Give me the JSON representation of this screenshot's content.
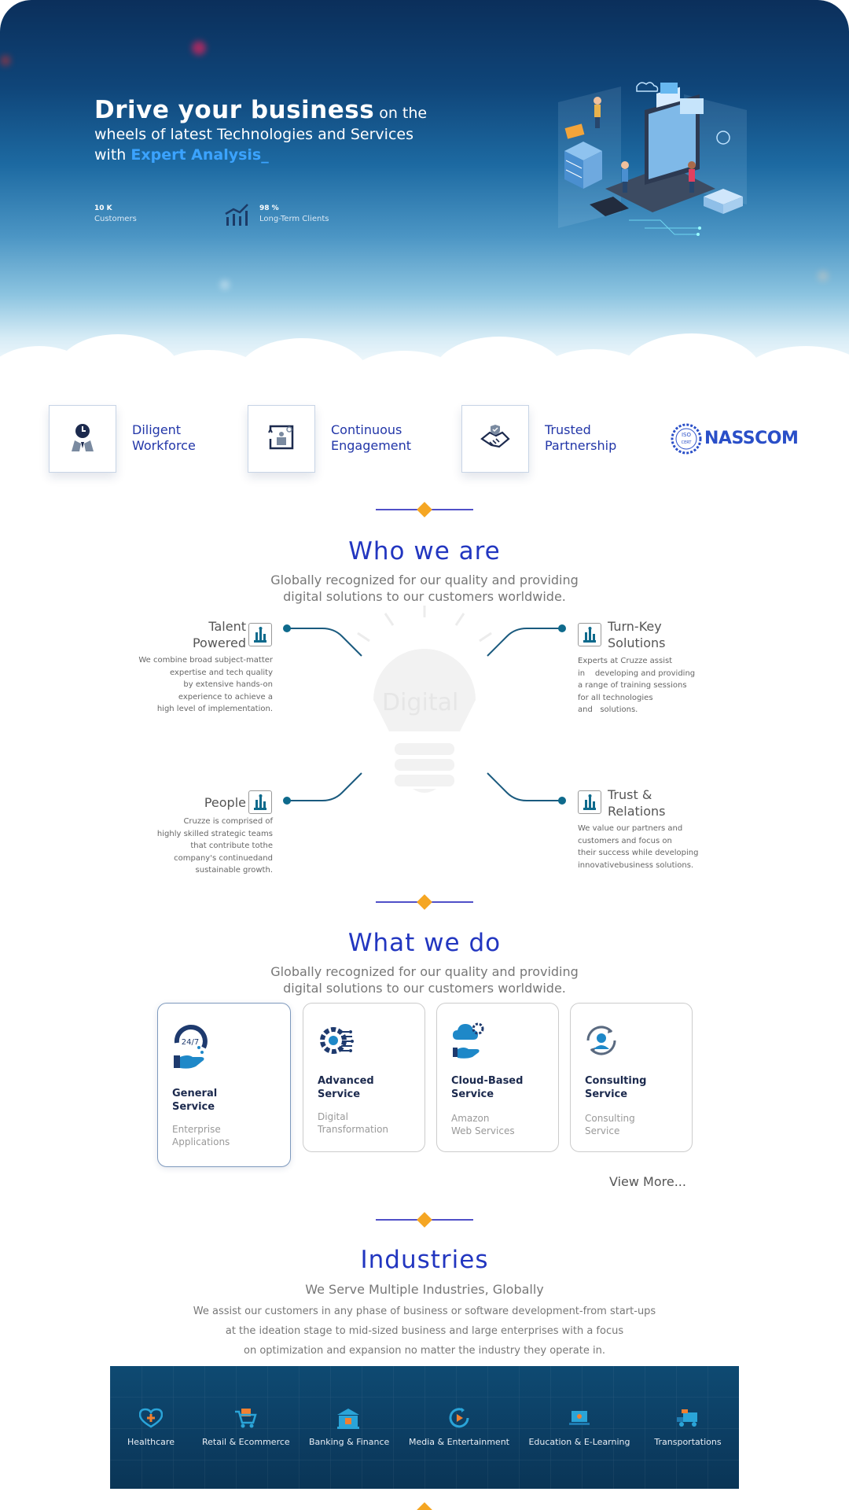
{
  "hero": {
    "headline_big": "Drive your business",
    "headline_small": " on the",
    "line2": "wheels of latest Technologies and Services",
    "line3_prefix": "with ",
    "line3_accent": "Expert Analysis_",
    "stats": [
      {
        "value": "10 K",
        "label": "Customers"
      },
      {
        "value": "98 %",
        "label": "Long-Term Clients"
      }
    ]
  },
  "features": [
    {
      "line1": "Diligent",
      "line2": "Workforce",
      "icon": "workforce-icon"
    },
    {
      "line1": "Continuous",
      "line2": "Engagement",
      "icon": "engagement-icon"
    },
    {
      "line1": "Trusted",
      "line2": "Partnership",
      "icon": "handshake-icon"
    }
  ],
  "nasscom": {
    "label": "NASSCOM",
    "badge": "ISO CERTIFIED"
  },
  "who": {
    "title": "Who we are",
    "sub1": "Globally recognized for our quality and providing",
    "sub2": "digital solutions to our customers worldwide.",
    "bulb_text": "Digital",
    "items": [
      {
        "title1": "Talent",
        "title2": "Powered",
        "desc": [
          "We combine broad subject-matter",
          "expertise and tech quality",
          "by extensive hands-on",
          "experience to achieve a",
          "high level of implementation."
        ]
      },
      {
        "title1": "Turn-Key",
        "title2": "Solutions",
        "desc": [
          "Experts at Cruzze assist",
          "in    developing and providing",
          "a range of training sessions",
          "for all technologies",
          "and   solutions."
        ]
      },
      {
        "title1": "People",
        "title2": "",
        "desc": [
          "Cruzze is comprised of",
          "highly skilled strategic teams",
          "that contribute tothe",
          "company's continuedand",
          "sustainable growth."
        ]
      },
      {
        "title1": "Trust &",
        "title2": "Relations",
        "desc": [
          "We value our partners and",
          "customers and focus on",
          "their success while developing",
          "innovativebusiness solutions."
        ]
      }
    ]
  },
  "what": {
    "title": "What we do",
    "sub1": "Globally recognized for our quality and providing",
    "sub2": "digital solutions to our customers worldwide.",
    "cards": [
      {
        "t1": "General",
        "t2": "Service",
        "s1": "Enterprise",
        "s2": "Applications",
        "icon": "24-7-support-icon"
      },
      {
        "t1": "Advanced",
        "t2": "Service",
        "s1": "Digital",
        "s2": "Transformation",
        "icon": "gear-circuit-icon"
      },
      {
        "t1": "Cloud-Based",
        "t2": "Service",
        "s1": "Amazon",
        "s2": "Web Services",
        "icon": "cloud-hand-icon"
      },
      {
        "t1": "Consulting",
        "t2": "Service",
        "s1": "Consulting",
        "s2": "Service",
        "icon": "consultant-icon"
      }
    ],
    "view_more": "View More..."
  },
  "industries": {
    "title": "Industries",
    "sub": "We Serve Multiple Industries, Globally",
    "desc": [
      "We assist our customers in any phase of business or software development-from start-ups",
      "at the ideation stage to mid-sized business and large enterprises with a focus",
      "on optimization and expansion no matter the industry they operate in."
    ],
    "items": [
      {
        "label": "Healthcare",
        "icon": "heart-plus-icon"
      },
      {
        "label": "Retail & Ecommerce",
        "icon": "shopping-cart-icon"
      },
      {
        "label": "Banking & Finance",
        "icon": "bank-icon"
      },
      {
        "label": "Media & Entertainment",
        "icon": "media-play-icon"
      },
      {
        "label": "Education & E-Learning",
        "icon": "laptop-icon"
      },
      {
        "label": "Transportations",
        "icon": "truck-icon"
      }
    ]
  },
  "colors": {
    "accent": "#2236c0",
    "diamond": "#f5a623",
    "teal": "#0e6a8c",
    "hero_accent": "#3ba3ff"
  }
}
